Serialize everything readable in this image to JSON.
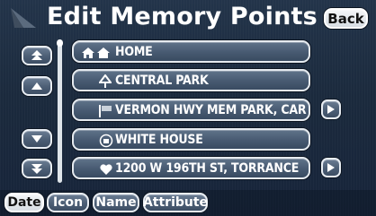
{
  "header": {
    "title": "Edit Memory Points",
    "back_label": "Back"
  },
  "list": {
    "items": [
      {
        "label": "HOME",
        "icon": "home-icon"
      },
      {
        "label": "CENTRAL PARK",
        "icon": "park-icon"
      },
      {
        "label": "VERMON HWY MEM PARK, CAR",
        "icon": "flag-icon",
        "has_more": true
      },
      {
        "label": "WHITE HOUSE",
        "icon": "building-icon"
      },
      {
        "label": "1200 W 196TH ST, TORRANCE",
        "icon": "heart-icon",
        "has_more": true
      }
    ]
  },
  "sort_tabs": [
    {
      "label": "Date",
      "selected": true
    },
    {
      "label": "Icon",
      "selected": false
    },
    {
      "label": "Name",
      "selected": false
    },
    {
      "label": "Attribute",
      "selected": false
    }
  ],
  "colors": {
    "background": "#1b2a3d",
    "button": "#4c5e75",
    "selected_tab": "#e6eaee",
    "text": "#ffffff"
  }
}
